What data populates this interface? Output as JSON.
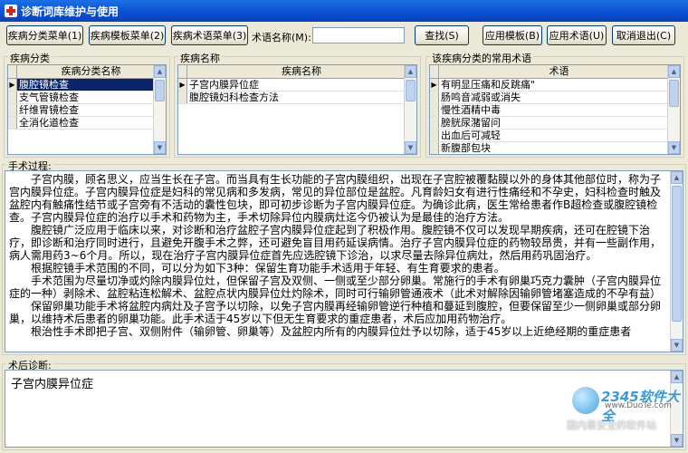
{
  "window": {
    "title": "诊断词库维护与使用"
  },
  "toolbar": {
    "btn_disease_category": "疾病分类菜单(1)",
    "btn_disease_template": "疾病模板菜单(2)",
    "btn_disease_term": "疾病术语菜单(3)",
    "term_name_label": "术语名称(M):",
    "term_name_value": "",
    "btn_search": "查找(S)",
    "btn_apply_template": "应用模板(B)",
    "btn_apply_term": "应用术语(U)",
    "btn_cancel_exit": "取消退出(C)"
  },
  "category_panel": {
    "group_label": "疾病分类",
    "column_header": "疾病分类名称",
    "rows": [
      "腹腔镜检查",
      "支气管镜检查",
      "纤维胃镜检查",
      "全消化道检查"
    ]
  },
  "disease_panel": {
    "group_label": "疾病名称",
    "column_header": "疾病名称",
    "rows": [
      "子宫内膜异位症",
      "腹腔镜妇科检查方法"
    ]
  },
  "terms_panel": {
    "group_label": "该疾病分类的常用术语",
    "column_header": "术语",
    "rows": [
      "有明显压痛和反跳痛\"",
      "肠鸣音减弱或消失",
      "慢性酒精中毒",
      "膀胱尿潴留问",
      "出血后可减轻",
      "新腹部包块"
    ]
  },
  "procedure": {
    "label": "手术过程:",
    "paragraphs": [
      "子宫内膜，顾名思义，应当生长在子宫。而当具有生长功能的子宫内膜组织，出现在子宫腔被覆黏膜以外的身体其他部位时，称为子宫内膜异位症。子宫内膜异位症是妇科的常见病和多发病，常见的异位部位是盆腔。凡育龄妇女有进行性痛经和不孕史，妇科检查时触及盆腔内有触痛性结节或子宫旁有不活动的囊性包块，即可初步诊断为子宫内膜异位症。为确诊此病，医生常给患者作B超检查或腹腔镜检查。子宫内膜异位症的治疗以手术和药物为主，手术切除异位内膜病灶迄今仍被认为是最佳的治疗方法。",
      "腹腔镜广泛应用于临床以来，对诊断和治疗盆腔子宫内膜异位症起到了积极作用。腹腔镜不仅可以发现早期疾病，还可在腔镜下治疗，即诊断和治疗同时进行，且避免开腹手术之弊，还可避免盲目用药延误病情。治疗子宫内膜异位症的药物较昂贵，并有一些副作用，病人需用药3~6个月。所以，现在治疗子宫内膜异位症首先应选腔镜下诊治，以求尽量去除异位病灶，然后用药巩固治疗。",
      "根据腔镜手术范围的不同，可以分为如下3种：保留生育功能手术适用于年轻、有生育要求的患者。",
      "手术范围为尽量切净或灼除内膜异位灶，但保留子宫及双侧、一侧或至少部分卵巢。常施行的手术有卵巢巧克力囊肿（子宫内膜异位症的一种）剥除术、盆腔粘连松解术、盆腔点状内膜异位灶灼除术，同时可行输卵管通液术（此术对解除因输卵管堵塞造成的不孕有益）",
      "保留卵巢功能手术将盆腔内病灶及子宫予以切除，以免子宫内膜再经输卵管逆行种植和蔓延到腹腔，但要保留至少一侧卵巢或部分卵巢，以维持术后患者的卵巢功能。此手术适于45岁以下但无生育要求的重症患者，术后应加用药物治疗。",
      "根治性手术即把子宫、双侧附件（输卵管、卵巢等）及盆腔内所有的内膜异位灶予以切除，适于45岁以上近绝经期的重症患者"
    ]
  },
  "diagnosis": {
    "label": "术后诊断:",
    "value": "子宫内膜异位症"
  },
  "watermark": {
    "logo": "2345软件大全",
    "url": "www.DuoTe.com",
    "slogan": "国内最安全的软件站"
  },
  "colors": {
    "title_bar": "#0a4fd0",
    "selection": "#0a246a",
    "window_bg": "#ece9d8"
  }
}
